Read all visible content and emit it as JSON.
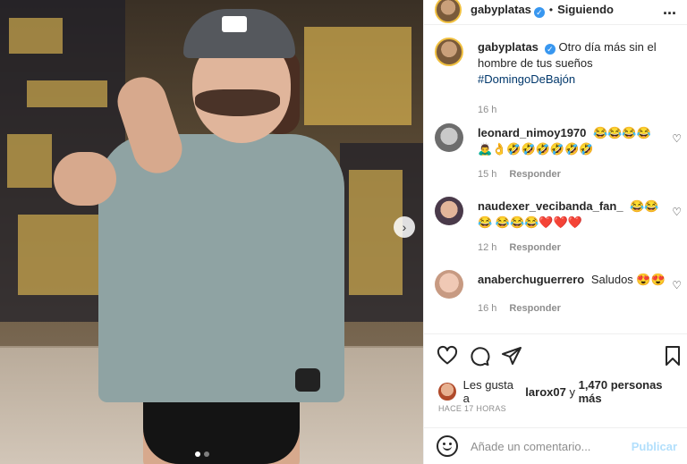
{
  "header": {
    "username": "gabyplatas",
    "separator": "•",
    "follow_status": "Siguiendo",
    "more_label": "..."
  },
  "caption": {
    "username": "gabyplatas",
    "text": "Otro día más sin el hombre de tus sueños",
    "hashtag": "#DomingoDeBajón",
    "time": "16 h"
  },
  "comments": [
    {
      "username": "leonard_nimoy1970",
      "text": "😂😂😂😂 🙇‍♂️👌🤣🤣🤣🤣🤣🤣",
      "time": "15 h",
      "reply": "Responder"
    },
    {
      "username": "naudexer_vecibanda_fan_",
      "text": "😂😂😂 😂😂😂❤️❤️❤️",
      "time": "12 h",
      "reply": "Responder"
    },
    {
      "username": "anaberchuguerrero",
      "text": "Saludos 😍😍",
      "time": "16 h",
      "reply": "Responder"
    }
  ],
  "likes": {
    "prefix": "Les gusta a",
    "user": "larox07",
    "middle": "y",
    "count": "1,470 personas más"
  },
  "post_time": "HACE 17 HORAS",
  "add_comment": {
    "placeholder": "Añade un comentario...",
    "publish_label": "Publicar"
  },
  "icons": {
    "like": "heart-icon",
    "comment": "comment-icon",
    "share": "share-icon",
    "save": "bookmark-icon",
    "emoji": "emoji-icon",
    "next": "chevron-right-icon"
  },
  "colors": {
    "verified": "#3897f0",
    "hashtag": "#00376b",
    "publish": "#b2dffc",
    "muted": "#8e8e8e"
  }
}
